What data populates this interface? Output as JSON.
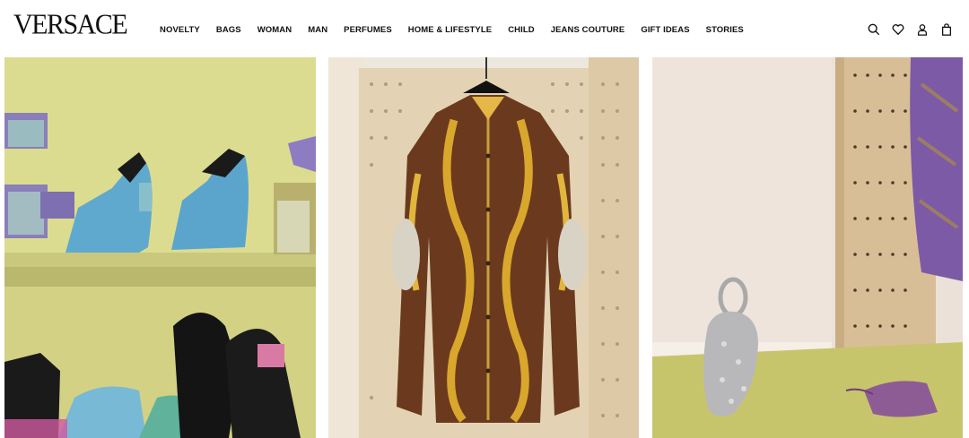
{
  "brand": {
    "logo_text": "VERSACE"
  },
  "nav": {
    "items": [
      {
        "label": "NOVELTY"
      },
      {
        "label": "BAGS"
      },
      {
        "label": "WOMAN"
      },
      {
        "label": "MAN"
      },
      {
        "label": "PERFUMES"
      },
      {
        "label": "HOME & LIFESTYLE"
      },
      {
        "label": "CHILD"
      },
      {
        "label": "JEANS COUTURE"
      },
      {
        "label": "GIFT IDEAS"
      },
      {
        "label": "STORIES"
      }
    ]
  },
  "header_icons": [
    "search-icon",
    "heart-icon",
    "account-icon",
    "shopping-bag-icon"
  ],
  "tiles": [
    {
      "subject": "shoes-and-perfume-shelf"
    },
    {
      "subject": "baroque-silk-shirt"
    },
    {
      "subject": "crystal-mesh-bag"
    }
  ],
  "colors": {
    "text": "#111111",
    "background": "#ffffff"
  }
}
